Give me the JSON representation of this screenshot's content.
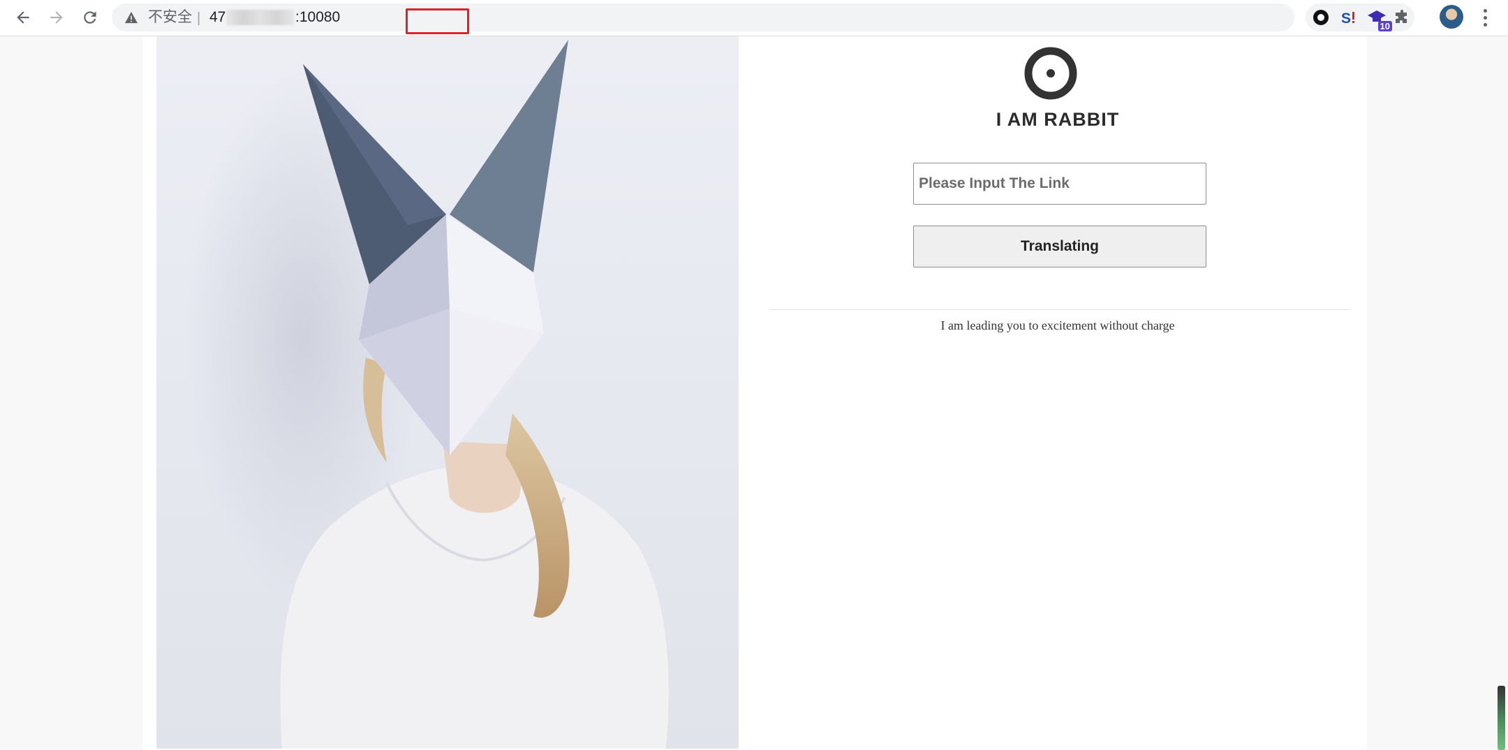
{
  "browser": {
    "security_label": "不安全",
    "separator": "|",
    "url_host": "47",
    "url_port": ":10080",
    "extension_badge": "10",
    "highlight_color": "#e12027"
  },
  "site": {
    "title": "I AM RABBIT",
    "input_placeholder": "Please Input The Link",
    "button_label": "Translating",
    "tagline": "I am leading you to excitement without charge"
  },
  "icons": {
    "back": "arrow-left-icon",
    "forward": "arrow-right-icon",
    "reload": "reload-icon",
    "security": "warning-triangle-icon",
    "bookmark": "star-icon",
    "extensions": [
      "circle-extension-icon",
      "s-extension-icon",
      "cap-extension-icon",
      "puzzle-icon"
    ],
    "menu": "three-dots-icon",
    "logo": "target-circle-logo"
  }
}
